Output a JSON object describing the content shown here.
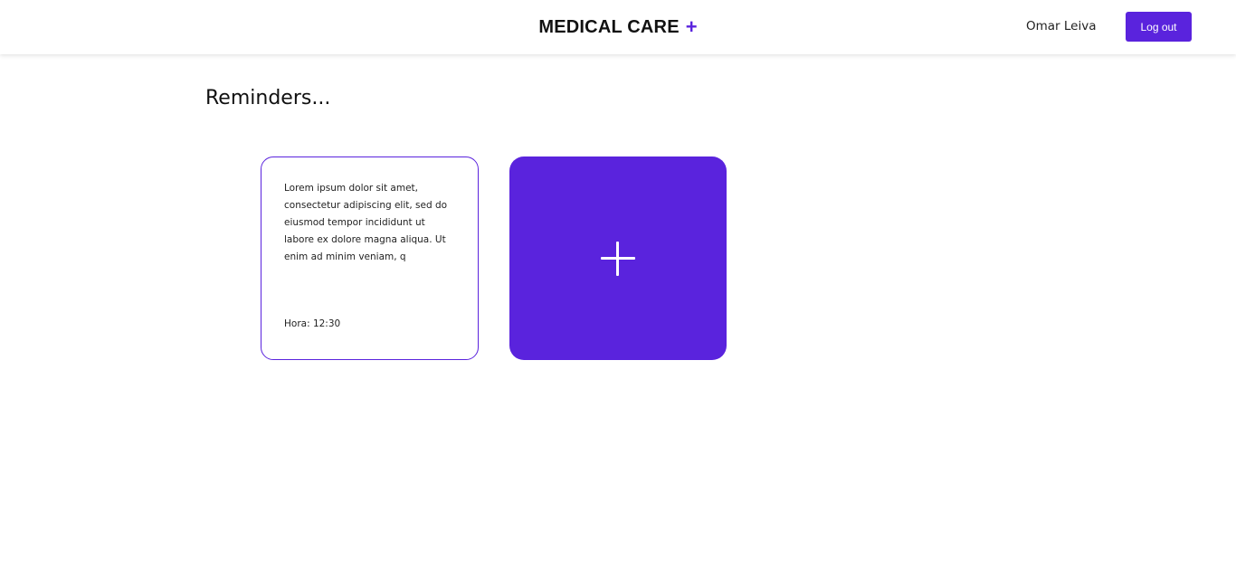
{
  "header": {
    "brand": "MEDICAL CARE",
    "brand_plus": "+",
    "user_name": "Omar Leiva",
    "logout_label": "Log out"
  },
  "main": {
    "title": "Reminders...",
    "reminders": [
      {
        "text": "Lorem ipsum dolor sit amet, consectetur adipiscing elit, sed do eiusmod tempor incididunt ut labore ex dolore magna aliqua. Ut enim ad minim veniam, q",
        "time": "Hora: 12:30"
      }
    ],
    "add_card": {
      "icon": "plus-icon"
    }
  },
  "colors": {
    "accent": "#5a23dd",
    "text": "#111111",
    "background": "#ffffff"
  }
}
